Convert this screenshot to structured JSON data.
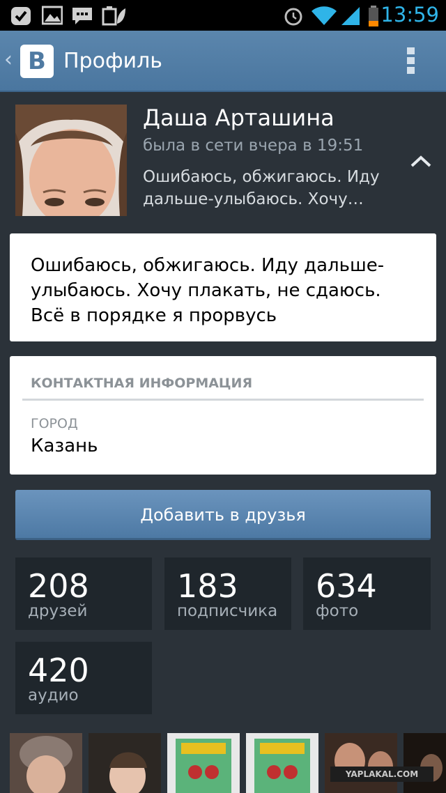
{
  "status_bar": {
    "time": "13:59",
    "accent": "#2fb4e8",
    "icons": [
      "check-notification-icon",
      "image-notification-icon",
      "chat-notification-icon",
      "battery-saver-icon",
      "alarm-icon",
      "wifi-icon",
      "signal-icon",
      "battery-icon"
    ]
  },
  "action_bar": {
    "logo_letter": "B",
    "title": "Профиль"
  },
  "profile": {
    "name": "Даша Арташина",
    "last_seen": "была в сети вчера в 19:51",
    "status_preview": "Ошибаюсь, обжигаюсь. Иду дальше-улыбаюсь. Хочу…"
  },
  "status_card": {
    "text": "Ошибаюсь, обжигаюсь. Иду дальше-улыбаюсь. Хочу плакать, не сдаюсь. Всё в порядке я прорвусь"
  },
  "contact": {
    "heading": "КОНТАКТНАЯ ИНФОРМАЦИЯ",
    "city_label": "ГОРОД",
    "city_value": "Казань"
  },
  "add_friend_label": "Добавить в друзья",
  "counters": [
    {
      "value": "208",
      "label": "друзей"
    },
    {
      "value": "183",
      "label": "подписчика"
    },
    {
      "value": "634",
      "label": "фото"
    },
    {
      "value": "420",
      "label": "аудио"
    }
  ],
  "watermark": "YAPLAKAL.COM",
  "colors": {
    "background": "#2b3239",
    "action_bar": "#4f7aa2",
    "card": "#ffffff",
    "counter_bg": "#1f262c"
  }
}
